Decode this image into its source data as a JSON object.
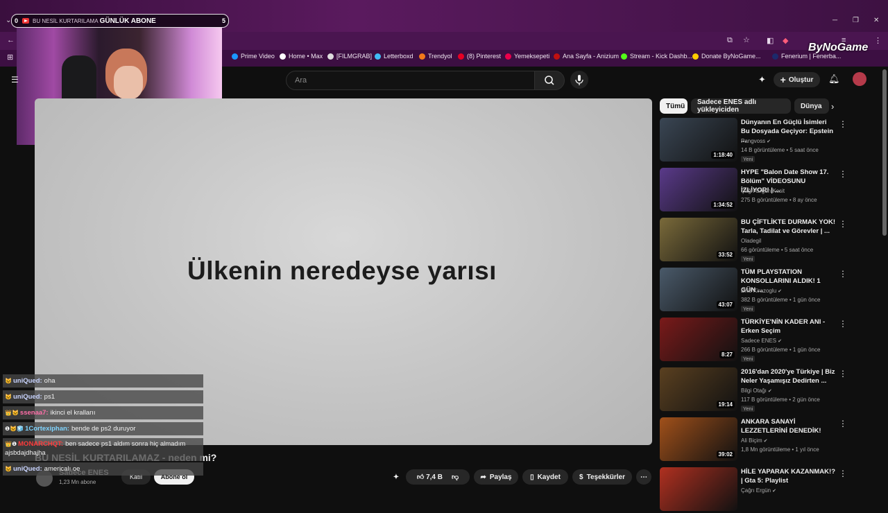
{
  "overlay": {
    "left_num": "0",
    "text1": "BU NESİL KURTARILAMA",
    "text2": "GÜNLÜK ABONE",
    "right_num": "5"
  },
  "bookmarks": [
    {
      "label": "Prime Video",
      "color": "#1a98ff"
    },
    {
      "label": "Home • Max",
      "color": "#ffffff"
    },
    {
      "label": "[FILMGRAB]",
      "color": "#dddddd"
    },
    {
      "label": "Letterboxd",
      "color": "#40bcf4"
    },
    {
      "label": "Trendyol",
      "color": "#f27a1a"
    },
    {
      "label": "(8) Pinterest",
      "color": "#e60023"
    },
    {
      "label": "Yemeksepeti",
      "color": "#ea004b"
    },
    {
      "label": "Ana Sayfa - Anizium",
      "color": "#c01010"
    },
    {
      "label": "Stream - Kick Dashb...",
      "color": "#53fc18"
    },
    {
      "label": "Donate ByNoGame...",
      "color": "#ffcc00"
    },
    {
      "label": "Fenerium | Fenerba...",
      "color": "#1c2a6b"
    }
  ],
  "watermark": "ByNoGame",
  "header": {
    "search_placeholder": "Ara",
    "create_label": "Oluştur"
  },
  "video": {
    "caption": "Ülkenin neredeyse yarısı",
    "title": "BU NESİL KURTARILAMAZ - neden mi?"
  },
  "channel": {
    "name": "Sadece ENES",
    "subs": "1,23 Mn abone",
    "join_label": "Katıl",
    "subscribe_label": "Abone ol"
  },
  "actions": {
    "likes": "7,4 B",
    "share": "Paylaş",
    "save": "Kaydet",
    "thanks": "Teşekkürler"
  },
  "chat": [
    {
      "badges": "😺",
      "user": "uniQued:",
      "user_color": "#c9d4ff",
      "msg": "oha"
    },
    {
      "badges": "😺",
      "user": "uniQued:",
      "user_color": "#c9d4ff",
      "msg": "ps1"
    },
    {
      "badges": "👑😺",
      "user": "ssenaa7:",
      "user_color": "#ff6ea8",
      "msg": "ikinci el krallarıı"
    },
    {
      "badges": "❶😺🧊",
      "user": "1Cortexiphan:",
      "user_color": "#7fd4ff",
      "msg": "bende de ps2 duruyor"
    },
    {
      "badges": "👑❶",
      "user": "MONARCHQT:",
      "user_color": "#ff3b3b",
      "msg": "ben sadece ps1 aldım sonra hiç almadım ajsbdajdhajha"
    },
    {
      "badges": "😺",
      "user": "uniQued:",
      "user_color": "#c9d4ff",
      "msg": "americalı oe"
    }
  ],
  "chips": [
    "Tümü",
    "Sadece ENES adlı yükleyiciden",
    "Dünya"
  ],
  "recommended": [
    {
      "title": "Dünyanın En Güçlü İsimleri Bu Dosyada Geçiyor: Epstein ...",
      "channel": "Pangvoss",
      "verified": true,
      "meta": "14 B görüntüleme • 5 saat önce",
      "badge": "Yeni",
      "duration": "1:18:40",
      "thumb_color": "#3a4654"
    },
    {
      "title": "HYPE \"Balon Date Show 17. Bölüm\" VİDEOSUNU İZLİYOR! | ...",
      "channel": "Çağrı Ergün Kesit",
      "verified": false,
      "meta": "275 B görüntüleme • 8 ay önce",
      "badge": "",
      "duration": "1:34:52",
      "thumb_color": "#5a3a8a"
    },
    {
      "title": "BU ÇİFTLİKTE DURMAK YOK! Tarla, Tadilat ve Görevler | ...",
      "channel": "Oladegil",
      "verified": false,
      "meta": "66 görüntüleme • 5 saat önce",
      "badge": "Yeni",
      "duration": "33:52",
      "thumb_color": "#7a6a3a"
    },
    {
      "title": "TÜM PLAYSTATION KONSOLLARINI ALDIK! 1 GÜN ...",
      "channel": "Enis Kirazoglu",
      "verified": true,
      "meta": "382 B görüntüleme • 1 gün önce",
      "badge": "Yeni",
      "duration": "43:07",
      "thumb_color": "#4a5a6a"
    },
    {
      "title": "TÜRKİYE'NİN KADER ANI - Erken Seçim",
      "channel": "Sadece ENES",
      "verified": true,
      "meta": "266 B görüntüleme • 1 gün önce",
      "badge": "Yeni",
      "duration": "8:27",
      "thumb_color": "#7a1a1a"
    },
    {
      "title": "2016'dan 2020'ye Türkiye | Biz Neler Yaşamışız Dedirten ...",
      "channel": "Bilgi Otağı",
      "verified": true,
      "meta": "117 B görüntüleme • 2 gün önce",
      "badge": "Yeni",
      "duration": "19:14",
      "thumb_color": "#5a4020"
    },
    {
      "title": "ANKARA SANAYİ LEZZETLERİNİ DENEDİK!",
      "channel": "Ali Biçim",
      "verified": true,
      "meta": "1,8 Mn görüntüleme • 1 yıl önce",
      "badge": "",
      "duration": "39:02",
      "thumb_color": "#a0501a"
    },
    {
      "title": "HİLE YAPARAK KAZANMAK!? | Gta 5: Playlist",
      "channel": "Çağrı Ergün",
      "verified": true,
      "meta": "",
      "badge": "",
      "duration": "",
      "thumb_color": "#b03020"
    }
  ]
}
